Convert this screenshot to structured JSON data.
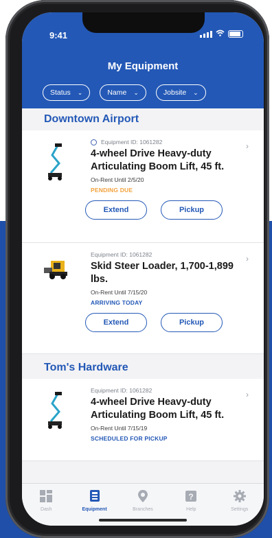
{
  "status_bar": {
    "time": "9:41"
  },
  "header": {
    "title": "My Equipment",
    "filters": [
      {
        "label": "Status"
      },
      {
        "label": "Name"
      },
      {
        "label": "Jobsite"
      }
    ]
  },
  "sections": [
    {
      "title": "Downtown Airport",
      "items": [
        {
          "equipment_id": "Equipment ID: 1061282",
          "name": "4-wheel Drive Heavy-duty Articulating Boom Lift, 45 ft.",
          "rent": "On-Rent Until 2/5/20",
          "status": "PENDING DUE",
          "extend_label": "Extend",
          "pickup_label": "Pickup"
        },
        {
          "equipment_id": "Equipment ID: 1061282",
          "name": "Skid Steer Loader, 1,700-1,899 lbs.",
          "rent": "On-Rent Until 7/15/20",
          "status": "ARRIVING TODAY",
          "extend_label": "Extend",
          "pickup_label": "Pickup"
        }
      ]
    },
    {
      "title": "Tom's Hardware",
      "items": [
        {
          "equipment_id": "Equipment ID: 1061282",
          "name": "4-wheel Drive Heavy-duty Articulating Boom Lift, 45 ft.",
          "rent": "On-Rent Until 7/15/19",
          "status": "SCHEDULED FOR PICKUP"
        }
      ]
    }
  ],
  "tabbar": [
    {
      "label": "Dash",
      "icon": "dashboard-icon"
    },
    {
      "label": "Equipment",
      "icon": "equipment-icon"
    },
    {
      "label": "Branches",
      "icon": "location-pin-icon"
    },
    {
      "label": "Help",
      "icon": "help-icon"
    },
    {
      "label": "Settings",
      "icon": "gear-icon"
    }
  ],
  "colors": {
    "brand_blue": "#2358b6",
    "pending": "#f2a13a",
    "arriving": "#2358b6",
    "scheduled": "#2358b6"
  }
}
